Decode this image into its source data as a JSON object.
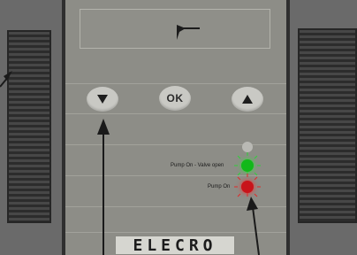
{
  "controls": {
    "ok_label": "OK",
    "down_icon": "triangle-down-icon",
    "up_icon": "triangle-up-icon"
  },
  "indicators": {
    "green_label": "Pump On - Valve open",
    "red_label": "Pump On",
    "colors": {
      "off": "#b9b9b4",
      "green": "#12b81a",
      "red": "#c8141a"
    }
  },
  "brand": {
    "name": "ELECRO"
  }
}
